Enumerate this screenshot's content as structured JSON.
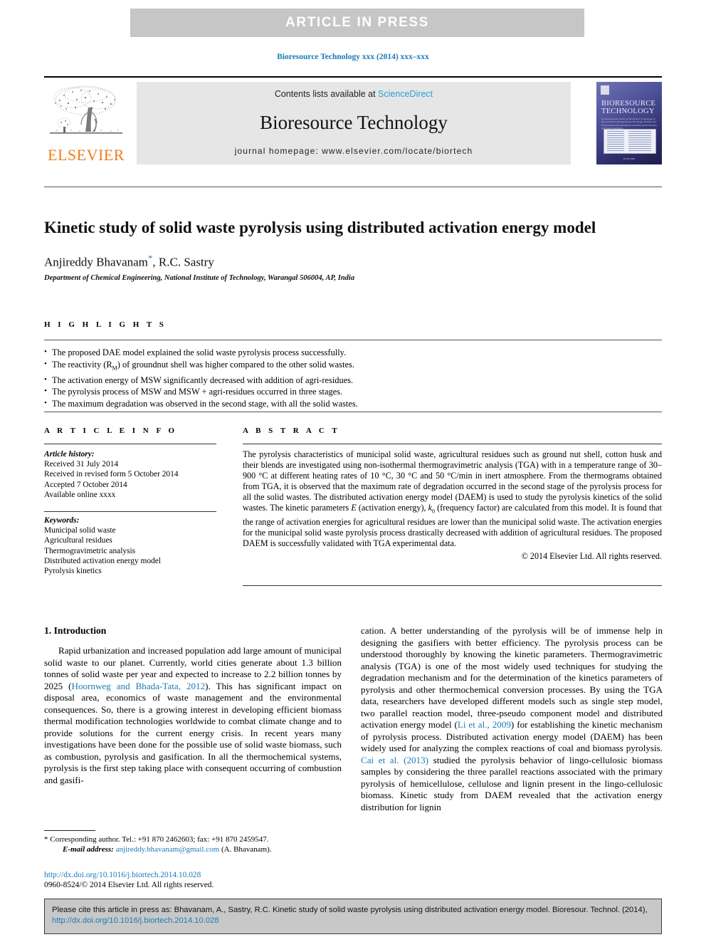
{
  "banner": {
    "text": "ARTICLE  IN  PRESS"
  },
  "journal_ref": "Bioresource Technology xxx (2014) xxx–xxx",
  "masthead": {
    "publisher_name": "ELSEVIER",
    "contents_prefix": "Contents lists available at ",
    "sciencedirect": "ScienceDirect",
    "journal_title": "Bioresource Technology",
    "homepage": "journal homepage: www.elsevier.com/locate/biortech",
    "cover": {
      "title_line1": "BIORESOURCE",
      "title_line2": "TECHNOLOGY",
      "subtitle": "An International Journal on Bioresource Technology for Bioconversion, Biodegradation, Bioenergy, Biofuels and Environmental Bioremediation including related biomass and waste valorisation",
      "footer": "ELSEVIER"
    }
  },
  "article": {
    "title": "Kinetic study of solid waste pyrolysis using distributed activation energy model",
    "authors": "Anjireddy Bhavanam",
    "corresponding_mark": "*",
    "authors_rest": ", R.C. Sastry",
    "affiliation": "Department of Chemical Engineering, National Institute of Technology, Warangal 506004, AP, India"
  },
  "highlights": {
    "label": "H I G H L I G H T S",
    "items": [
      "The proposed DAE model explained the solid waste pyrolysis process successfully.",
      "The activation energy of MSW significantly decreased with addition of agri-residues.",
      "The reactivity (RM) of groundnut shell was higher compared to the other solid wastes.",
      "The pyrolysis process of MSW and MSW + agri-residues occurred in three stages.",
      "The maximum degradation was observed in the second stage, with all the solid wastes."
    ]
  },
  "article_info": {
    "label": "A R T I C L E  I N F O",
    "history_head": "Article history:",
    "history": [
      "Received 31 July 2014",
      "Received in revised form 5 October 2014",
      "Accepted 7 October 2014",
      "Available online xxxx"
    ],
    "keywords_head": "Keywords:",
    "keywords": [
      "Municipal solid waste",
      "Agricultural residues",
      "Thermogravimetric analysis",
      "Distributed activation energy model",
      "Pyrolysis kinetics"
    ]
  },
  "abstract": {
    "label": "A B S T R A C T",
    "part1": "The pyrolysis characteristics of municipal solid waste, agricultural residues such as ground nut shell, cotton husk and their blends are investigated using non-isothermal thermogravimetric analysis (TGA) with in a temperature range of 30–900 °C at different heating rates of 10 °C, 30 °C and 50 °C/min in inert atmosphere. From the thermograms obtained from TGA, it is observed that the maximum rate of degradation occurred in the second stage of the pyrolysis process for all the solid wastes. The distributed activation energy model (DAEM) is used to study the pyrolysis kinetics of the solid wastes. The kinetic parameters ",
    "italic_E": "E",
    "part2": " (activation energy), ",
    "italic_k": "k",
    "sub_0": "0",
    "part3": " (frequency factor) are calculated from this model. It is found that the range of activation energies for agricultural residues are lower than the municipal solid waste. The activation energies for the municipal solid waste pyrolysis process drastically decreased with addition of agricultural residues. The proposed DAEM is successfully validated with TGA experimental data.",
    "copyright": "© 2014 Elsevier Ltd. All rights reserved."
  },
  "body": {
    "section_heading": "1. Introduction",
    "left_part1": "Rapid urbanization and increased population add large amount of municipal solid waste to our planet. Currently, world cities generate about 1.3 billion tonnes of solid waste per year and expected to increase to 2.2 billion tonnes by 2025 (",
    "left_ref1": "Hoornweg and Bhada-Tata, 2012",
    "left_part2": "). This has significant impact on disposal area, economics of waste management and the environmental consequences. So, there is a growing interest in developing efficient biomass thermal modification technologies worldwide to combat climate change and to provide solutions for the current energy crisis. In recent years many investigations have been done for the possible use of solid waste biomass, such as combustion, pyrolysis and gasification. In all the thermochemical systems, pyrolysis is the first step taking place with consequent occurring of combustion and gasifi-",
    "right_part1": "cation. A better understanding of the pyrolysis will be of immense help in designing the gasifiers with better efficiency. The pyrolysis process can be understood thoroughly by knowing the kinetic parameters. Thermogravimetric analysis (TGA) is one of the most widely used techniques for studying the degradation mechanism and for the determination of the kinetics parameters of pyrolysis and other thermochemical conversion processes. By using the TGA data, researchers have developed different models such as single step model, two parallel reaction model, three-pseudo component model and distributed activation energy model (",
    "right_ref1": "Li et al., 2009",
    "right_part2": ") for establishing the kinetic mechanism of pyrolysis process. Distributed activation energy model (DAEM) has been widely used for analyzing the complex reactions of coal and biomass pyrolysis. ",
    "right_ref2": "Cai et al. (2013)",
    "right_part3": " studied the pyrolysis behavior of lingo-cellulosic biomass samples by considering the three parallel reactions associated with the primary pyrolysis of hemicellulose, cellulose and lignin present in the lingo-cellulosic biomass. Kinetic study from DAEM revealed that the activation energy distribution for lignin"
  },
  "footnote": {
    "mark": "*",
    "corresponding": "Corresponding author. Tel.: +91 870 2462603; fax: +91 870 2459547.",
    "email_label": "E-mail address:",
    "email": "anjireddy.bhavanam@gmail.com",
    "email_owner": "(A. Bhavanam)."
  },
  "doi_block": {
    "doi_url": "http://dx.doi.org/10.1016/j.biortech.2014.10.028",
    "issn_line": "0960-8524/© 2014 Elsevier Ltd. All rights reserved."
  },
  "cite_box": {
    "text_before": "Please cite this article in press as: Bhavanam, A., Sastry, R.C. Kinetic study of solid waste pyrolysis using distributed activation energy model. Bioresour. Technol. (2014), ",
    "link": "http://dx.doi.org/10.1016/j.biortech.2014.10.028"
  },
  "colors": {
    "banner_bg": "#c6c6c6",
    "link_blue": "#1b7ab5",
    "sciencedirect_blue": "#2a9fd6",
    "elsevier_orange": "#ef7d1a",
    "band_gray": "#e6e6e6",
    "cite_box_bg": "#c8c8c8"
  }
}
